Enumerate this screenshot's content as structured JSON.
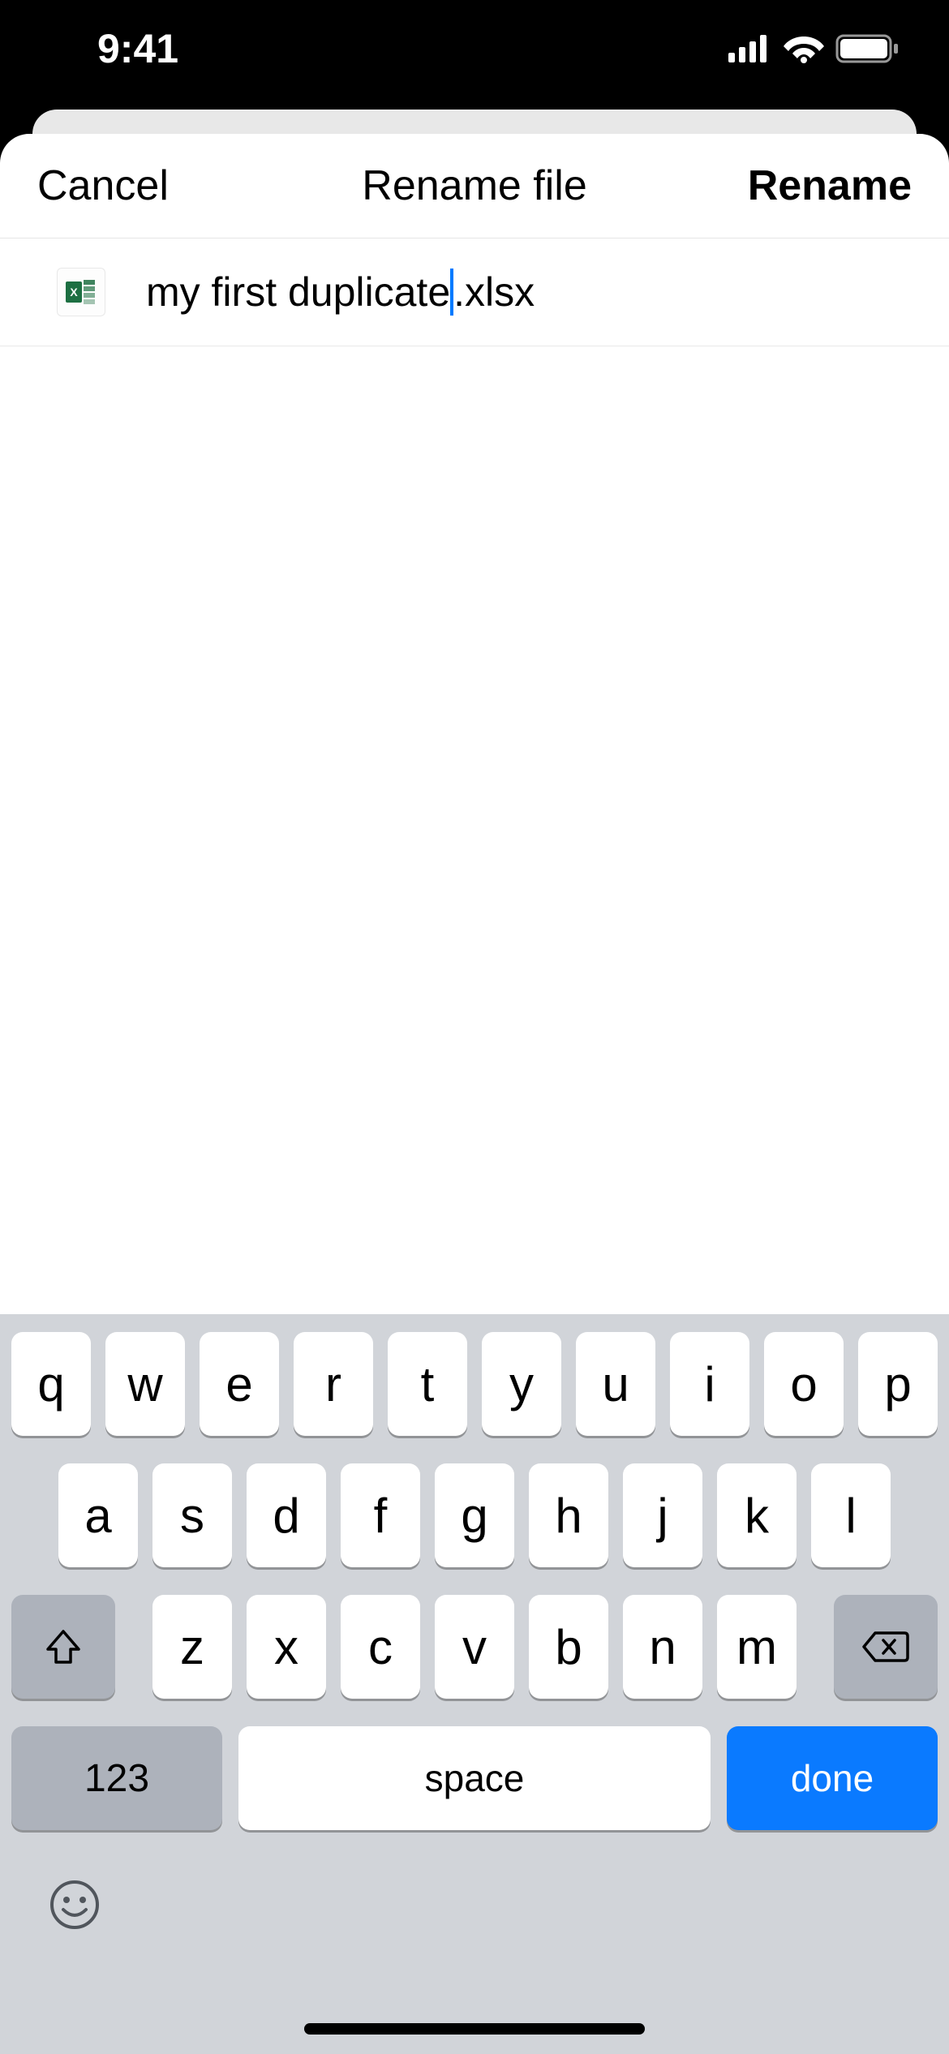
{
  "status": {
    "time": "9:41"
  },
  "modal": {
    "cancel": "Cancel",
    "title": "Rename file",
    "confirm": "Rename"
  },
  "file": {
    "name_before_cursor": "my first duplicate",
    "name_after_cursor": ".xlsx",
    "icon_label": "X"
  },
  "keyboard": {
    "row1": [
      "q",
      "w",
      "e",
      "r",
      "t",
      "y",
      "u",
      "i",
      "o",
      "p"
    ],
    "row2": [
      "a",
      "s",
      "d",
      "f",
      "g",
      "h",
      "j",
      "k",
      "l"
    ],
    "row3": [
      "z",
      "x",
      "c",
      "v",
      "b",
      "n",
      "m"
    ],
    "numbers": "123",
    "space": "space",
    "done": "done"
  }
}
